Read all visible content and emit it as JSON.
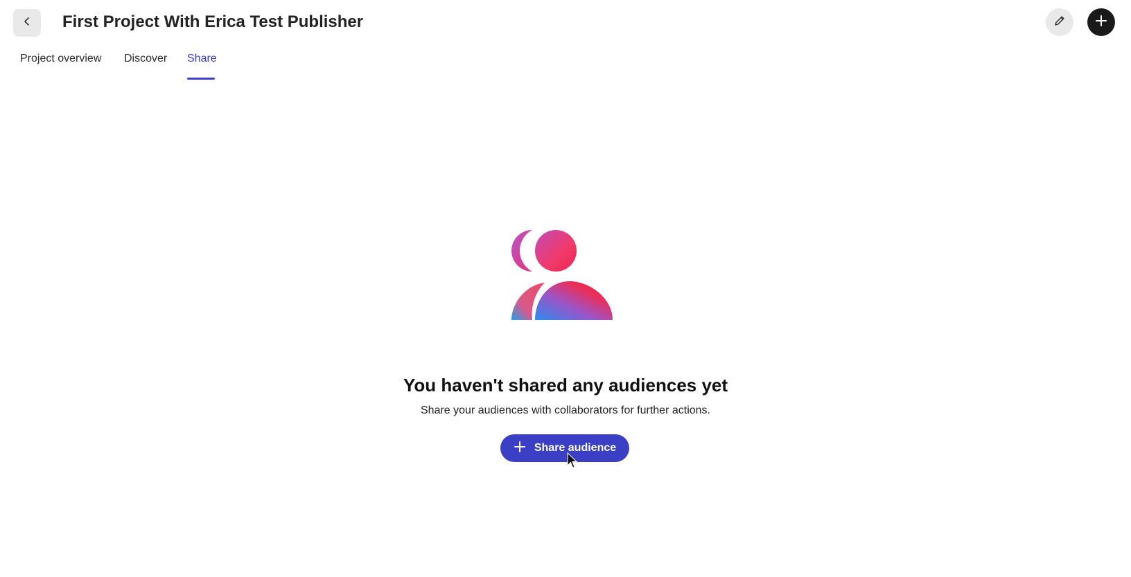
{
  "header": {
    "title": "First Project With Erica Test Publisher",
    "back_icon": "chevron-left-icon",
    "edit_icon": "pencil-icon",
    "add_icon": "plus-icon"
  },
  "tabs": [
    {
      "label": "Project overview",
      "active": false
    },
    {
      "label": "Discover",
      "active": false
    },
    {
      "label": "Share",
      "active": true
    }
  ],
  "colors": {
    "accent": "#3d3dc8",
    "button": "#3b3fc6"
  },
  "empty_state": {
    "illustration_icon": "users-icon",
    "title": "You haven't shared any audiences yet",
    "description": "Share your audiences with collaborators for further actions.",
    "button_label": "Share audience",
    "button_icon": "plus-icon"
  }
}
